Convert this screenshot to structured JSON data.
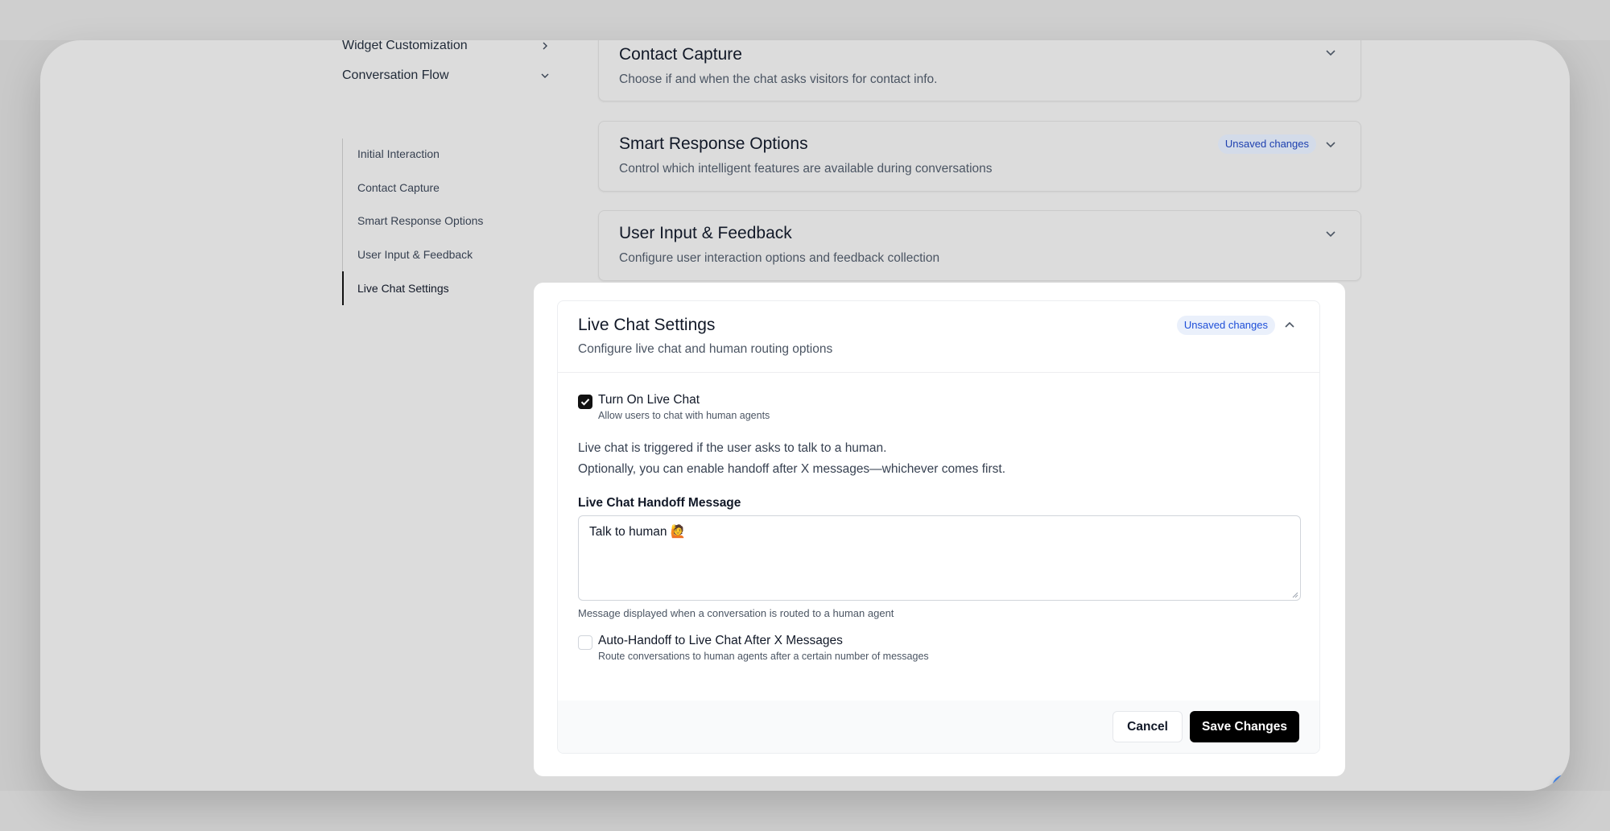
{
  "sidebar": {
    "widget_customization": "Widget Customization",
    "conversation_flow": "Conversation Flow",
    "sub_items": [
      {
        "label": "Initial Interaction"
      },
      {
        "label": "Contact Capture"
      },
      {
        "label": "Smart Response Options"
      },
      {
        "label": "User Input & Feedback"
      },
      {
        "label": "Live Chat Settings",
        "active": true
      }
    ]
  },
  "sections": {
    "contact_capture": {
      "title": "Contact Capture",
      "subtitle": "Choose if and when the chat asks visitors for contact info."
    },
    "smart_response": {
      "title": "Smart Response Options",
      "subtitle": "Control which intelligent features are available during conversations",
      "badge": "Unsaved changes"
    },
    "user_input": {
      "title": "User Input & Feedback",
      "subtitle": "Configure user interaction options and feedback collection"
    },
    "live_chat": {
      "title": "Live Chat Settings",
      "subtitle": "Configure live chat and human routing options",
      "badge": "Unsaved changes",
      "turn_on": {
        "label": "Turn On Live Chat",
        "description": "Allow users to chat with human agents",
        "checked": true
      },
      "info_line1": "Live chat is triggered if the user asks to talk to a human.",
      "info_line2": "Optionally, you can enable handoff after X messages—whichever comes first.",
      "handoff_label": "Live Chat Handoff Message",
      "handoff_value": "Talk to human 🙋",
      "handoff_help": "Message displayed when a conversation is routed to a human agent",
      "auto_handoff": {
        "label": "Auto-Handoff to Live Chat After X Messages",
        "description": "Route conversations to human agents after a certain number of messages",
        "checked": false
      },
      "cancel": "Cancel",
      "save": "Save Changes"
    }
  },
  "icons": {
    "chevron": "chevron-down-icon",
    "chat_widget": "chat-bubble-icon"
  },
  "colors": {
    "accent_badge_text": "#1d4ed8",
    "primary_button": "#000000",
    "chat_fab": "#3f7fe0"
  }
}
